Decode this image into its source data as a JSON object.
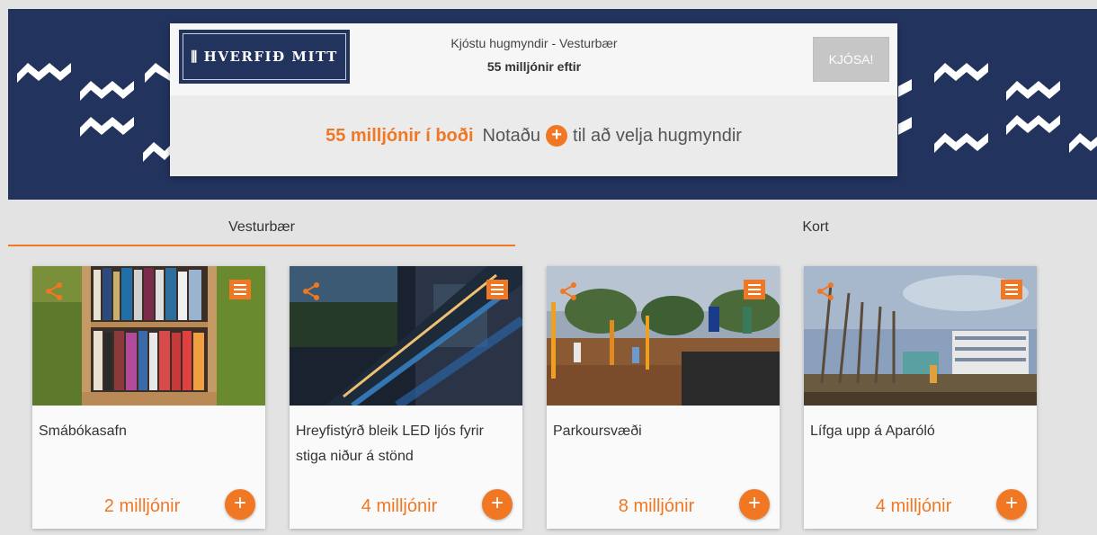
{
  "header": {
    "logo_text": "HVERFIÐ MITT",
    "vote_title": "Kjóstu hugmyndir - Vesturbær",
    "vote_remaining": "55 milljónir eftir",
    "vote_button": "KJÓSA!",
    "help_icon": "question-circle-icon",
    "help_label": "?"
  },
  "hint": {
    "budget": "55 milljónir í boði",
    "use": "Notaðu",
    "plus": "+",
    "rest": "til að velja hugmyndir"
  },
  "tabs": [
    {
      "label": "Vesturbær",
      "active": true
    },
    {
      "label": "Kort",
      "active": false
    }
  ],
  "ideas": [
    {
      "title": "Smábókasafn",
      "price": "2 milljónir",
      "add": "+"
    },
    {
      "title": "Hreyfistýrð bleik LED ljós fyrir stiga niður á stönd",
      "price": "4 milljónir",
      "add": "+"
    },
    {
      "title": "Parkoursvæði",
      "price": "8 milljónir",
      "add": "+"
    },
    {
      "title": "Lífga upp á Aparóló",
      "price": "4 milljónir",
      "add": "+"
    }
  ],
  "colors": {
    "accent": "#f07723",
    "navy": "#22335d",
    "disabled": "#c6c6c6"
  }
}
